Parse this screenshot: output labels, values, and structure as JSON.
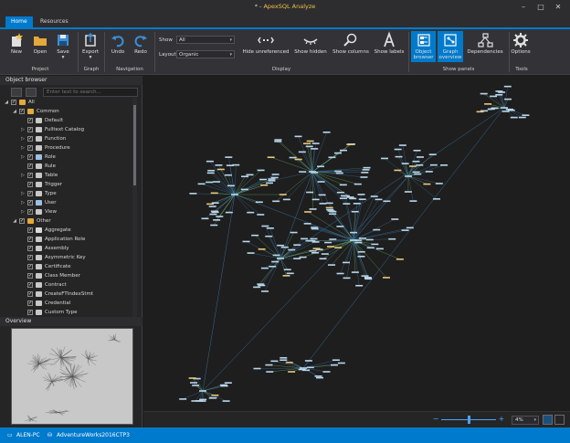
{
  "window": {
    "title_prefix": "* - ",
    "app_name": "ApexSQL Analyze",
    "controls": [
      "minimize-icon",
      "maximize-icon",
      "close-icon"
    ]
  },
  "tabs": [
    {
      "label": "Home",
      "active": true
    },
    {
      "label": "Resources",
      "active": false
    }
  ],
  "ribbon": {
    "project": {
      "group_label": "Project",
      "new_label": "New",
      "open_label": "Open",
      "save_label": "Save"
    },
    "graph": {
      "group_label": "Graph",
      "export_label": "Export"
    },
    "navigation": {
      "group_label": "Navigation",
      "undo_label": "Undo",
      "redo_label": "Redo"
    },
    "display": {
      "group_label": "Display",
      "show_label": "Show",
      "show_value": "All",
      "layout_label": "Layout",
      "layout_value": "Organic",
      "hide_unreferenced_label": "Hide unreferenced",
      "show_hidden_label": "Show hidden",
      "show_columns_label": "Show columns",
      "show_labels_label": "Show labels"
    },
    "show_panels": {
      "group_label": "Show panels",
      "object_browser_label": "Object browser",
      "graph_overview_label": "Graph overview",
      "dependencies_label": "Dependencies"
    },
    "tools": {
      "group_label": "Tools",
      "options_label": "Options"
    }
  },
  "object_browser": {
    "title": "Object browser",
    "search_placeholder": "Enter text to search...",
    "items": [
      {
        "label": "All",
        "level": 0,
        "expander": "◢",
        "icon": "folder-icon"
      },
      {
        "label": "Common",
        "level": 1,
        "expander": "◢",
        "icon": "folder-icon"
      },
      {
        "label": "Default",
        "level": 2,
        "expander": "",
        "icon": "default-icon"
      },
      {
        "label": "Fulltext Catalog",
        "level": 2,
        "expander": "▷",
        "icon": "fulltext-catalog-icon"
      },
      {
        "label": "Function",
        "level": 2,
        "expander": "▷",
        "icon": "function-icon"
      },
      {
        "label": "Procedure",
        "level": 2,
        "expander": "▷",
        "icon": "procedure-icon"
      },
      {
        "label": "Role",
        "level": 2,
        "expander": "▷",
        "icon": "role-icon"
      },
      {
        "label": "Rule",
        "level": 2,
        "expander": "",
        "icon": "rule-icon"
      },
      {
        "label": "Table",
        "level": 2,
        "expander": "▷",
        "icon": "table-icon"
      },
      {
        "label": "Trigger",
        "level": 2,
        "expander": "",
        "icon": "trigger-icon"
      },
      {
        "label": "Type",
        "level": 2,
        "expander": "▷",
        "icon": "type-icon"
      },
      {
        "label": "User",
        "level": 2,
        "expander": "▷",
        "icon": "user-icon"
      },
      {
        "label": "View",
        "level": 2,
        "expander": "▷",
        "icon": "view-icon"
      },
      {
        "label": "Other",
        "level": 1,
        "expander": "◢",
        "icon": "folder-icon"
      },
      {
        "label": "Aggregate",
        "level": 2,
        "expander": "",
        "icon": "aggregate-icon"
      },
      {
        "label": "Application Role",
        "level": 2,
        "expander": "",
        "icon": "application-role-icon"
      },
      {
        "label": "Assembly",
        "level": 2,
        "expander": "",
        "icon": "assembly-icon"
      },
      {
        "label": "Asymmetric Key",
        "level": 2,
        "expander": "",
        "icon": "asymmetric-key-icon"
      },
      {
        "label": "Certificate",
        "level": 2,
        "expander": "",
        "icon": "certificate-icon"
      },
      {
        "label": "Class Member",
        "level": 2,
        "expander": "",
        "icon": "class-member-icon"
      },
      {
        "label": "Contract",
        "level": 2,
        "expander": "",
        "icon": "contract-icon"
      },
      {
        "label": "CreateFTIndexStmt",
        "level": 2,
        "expander": "",
        "icon": "create-ft-index-icon"
      },
      {
        "label": "Credential",
        "level": 2,
        "expander": "",
        "icon": "credential-icon"
      },
      {
        "label": "Custom Type",
        "level": 2,
        "expander": "",
        "icon": "custom-type-icon"
      }
    ]
  },
  "overview": {
    "title": "Overview"
  },
  "zoom": {
    "value": "4%",
    "slider_fraction": 0.5
  },
  "status": {
    "machine": "ALEN-PC",
    "database": "AdventureWorks2016CTP3"
  },
  "colors": {
    "accent": "#007acc",
    "title_accent": "#f0c040",
    "node": "#b9d7ec",
    "node_highlight": "#e8c77a",
    "edge_blue": "#3e7fb5",
    "edge_green": "#7bbf6a"
  }
}
